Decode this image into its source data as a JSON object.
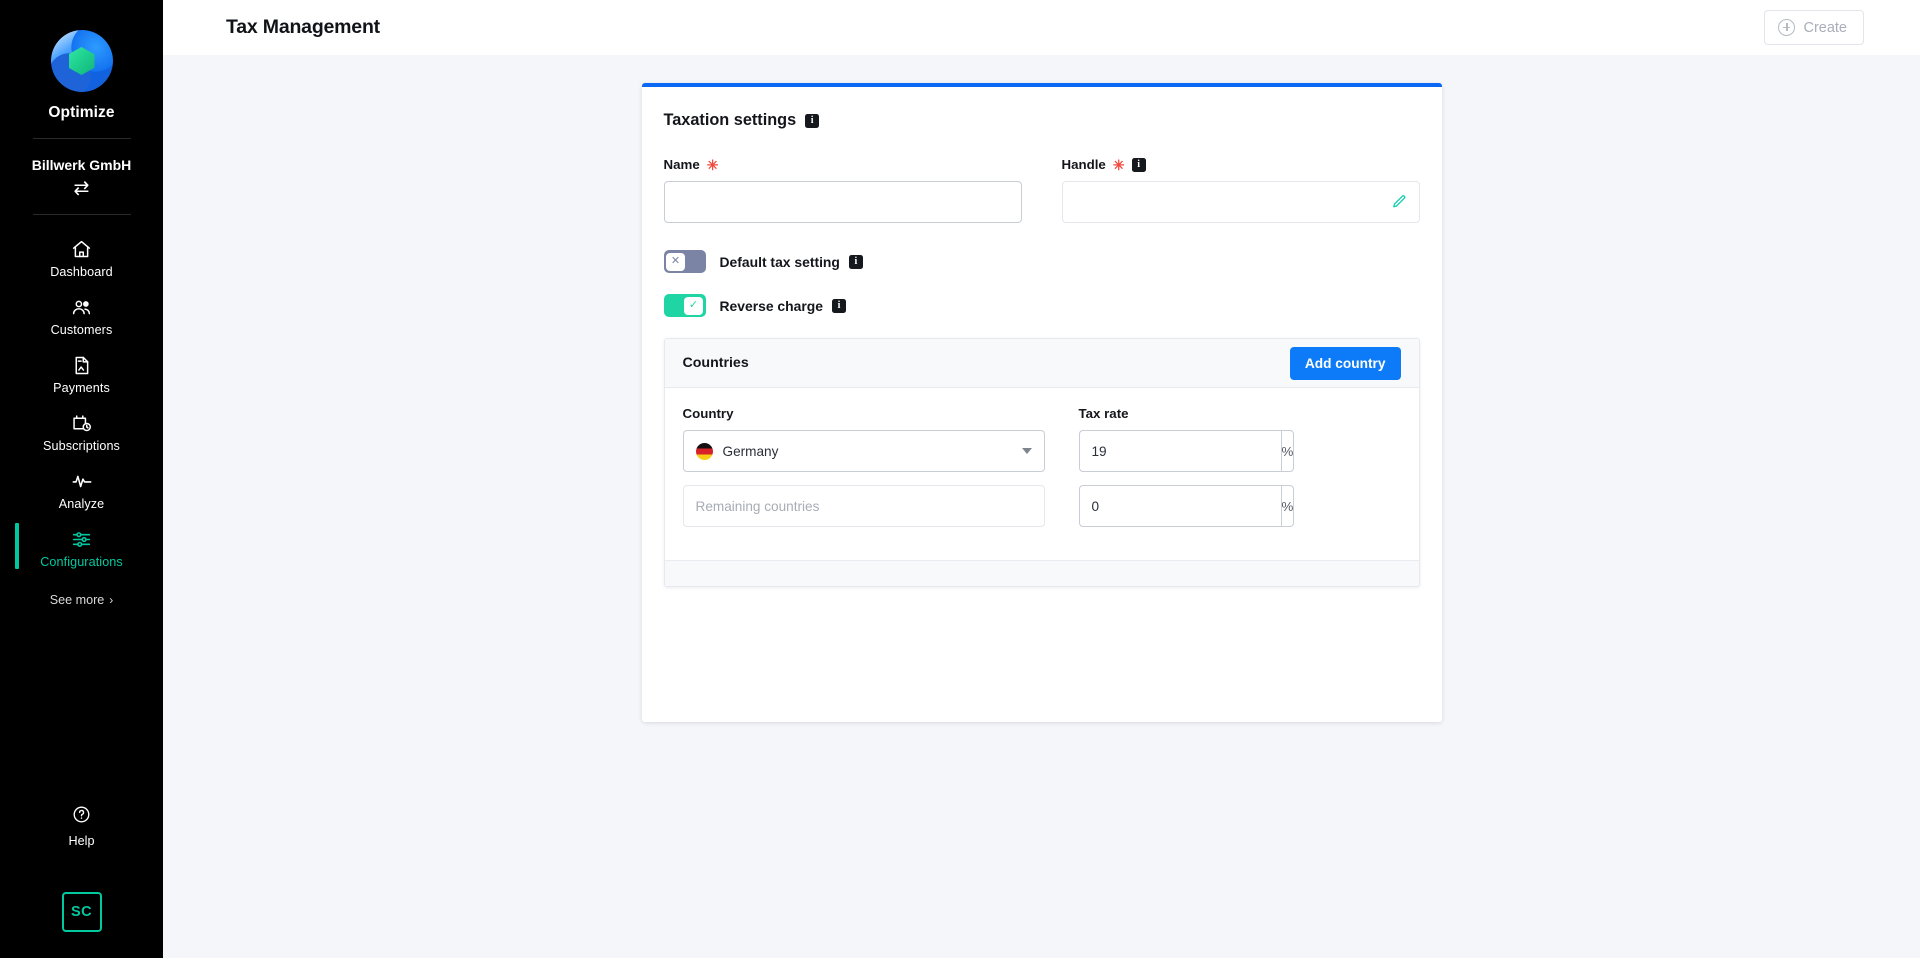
{
  "sidebar": {
    "brand": {
      "name": "Optimize",
      "logo_icon": "optimize-logo"
    },
    "organization": {
      "name": "Billwerk GmbH",
      "switch_icon": "switch-org-icon",
      "switch_glyph": "⇄"
    },
    "nav_items": [
      {
        "label": "Dashboard",
        "icon": "home-icon",
        "active": false
      },
      {
        "label": "Customers",
        "icon": "users-icon",
        "active": false
      },
      {
        "label": "Payments",
        "icon": "document-icon",
        "active": false
      },
      {
        "label": "Subscriptions",
        "icon": "calendar-clock-icon",
        "active": false
      },
      {
        "label": "Analyze",
        "icon": "pulse-icon",
        "active": false
      },
      {
        "label": "Configurations",
        "icon": "sliders-icon",
        "active": true
      }
    ],
    "see_more": {
      "label": "See more",
      "icon": "chevron-right-icon",
      "glyph": "›"
    },
    "help": {
      "label": "Help",
      "icon": "question-circle-icon"
    },
    "avatar": {
      "initials": "SC"
    },
    "accent_color": "#00c9a0",
    "background_color": "#000000"
  },
  "header": {
    "title": "Tax Management",
    "create_button": {
      "label": "Create",
      "icon": "plus-circle-icon",
      "disabled": true
    }
  },
  "card": {
    "accent_color": "#0a68f5",
    "title": "Taxation settings",
    "title_info_icon": "info-icon",
    "fields": {
      "name": {
        "label": "Name",
        "required": true,
        "value": "",
        "placeholder": ""
      },
      "handle": {
        "label": "Handle",
        "required": true,
        "value": "",
        "placeholder": "",
        "info_icon": "info-icon",
        "edit_icon": "pencil-icon"
      }
    },
    "toggles": [
      {
        "label": "Default tax setting",
        "state": "off",
        "knob_glyph": "✕",
        "info_icon": "info-icon",
        "off_color": "#7b84a4"
      },
      {
        "label": "Reverse charge",
        "state": "on",
        "knob_glyph": "✓",
        "info_icon": "info-icon",
        "on_color": "#1ed5a3"
      }
    ],
    "countries_panel": {
      "title": "Countries",
      "add_button": {
        "label": "Add country",
        "color": "#0d7bf7"
      },
      "columns": {
        "country": "Country",
        "tax_rate": "Tax rate"
      },
      "rows": [
        {
          "country_label": "Germany",
          "country_placeholder": "",
          "flag_icon": "flag-germany-icon",
          "has_flag": true,
          "disabled": false,
          "caret_icon": "chevron-down-icon",
          "rate_value": "19",
          "rate_suffix": "%"
        },
        {
          "country_label": "",
          "country_placeholder": "Remaining countries",
          "flag_icon": "",
          "has_flag": false,
          "disabled": true,
          "caret_icon": "",
          "rate_value": "0",
          "rate_suffix": "%"
        }
      ]
    }
  }
}
